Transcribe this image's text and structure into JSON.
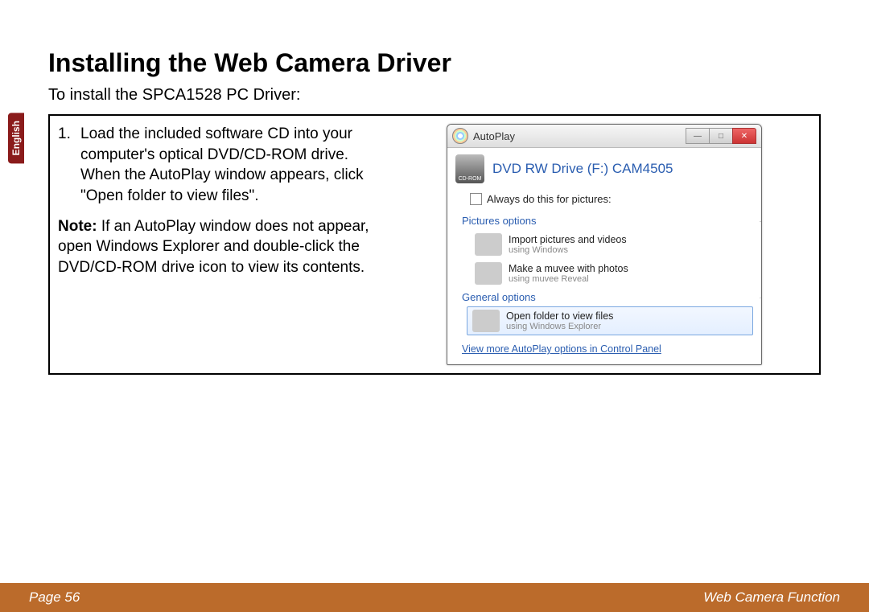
{
  "sideTab": "English",
  "page": {
    "title": "Installing the Web Camera Driver",
    "subtitle": "To install the SPCA1528 PC Driver:",
    "step_num": "1.",
    "step_text": "Load the included software CD into your computer's optical DVD/CD-ROM drive. When the AutoPlay window appears, click \"Open folder to view files\".",
    "note_label": "Note:",
    "note_text": " If an AutoPlay window does not appear, open Windows Explorer and double-click the DVD/CD-ROM drive icon to view its contents."
  },
  "autoplay": {
    "window_title": "AutoPlay",
    "drive_icon_label": "CD-ROM",
    "drive_label": "DVD RW Drive (F:) CAM4505",
    "always_label": "Always do this for pictures:",
    "pictures_section": "Pictures options",
    "opt1_line1": "Import pictures and videos",
    "opt1_line2": "using Windows",
    "opt2_line1": "Make a muvee with photos",
    "opt2_line2": "using muvee Reveal",
    "general_section": "General options",
    "opt3_line1": "Open folder to view files",
    "opt3_line2": "using Windows Explorer",
    "view_more": "View more AutoPlay options in Control Panel",
    "btn_min": "—",
    "btn_max": "□",
    "btn_close": "✕"
  },
  "footer": {
    "left": "Page 56",
    "right": "Web Camera Function"
  }
}
